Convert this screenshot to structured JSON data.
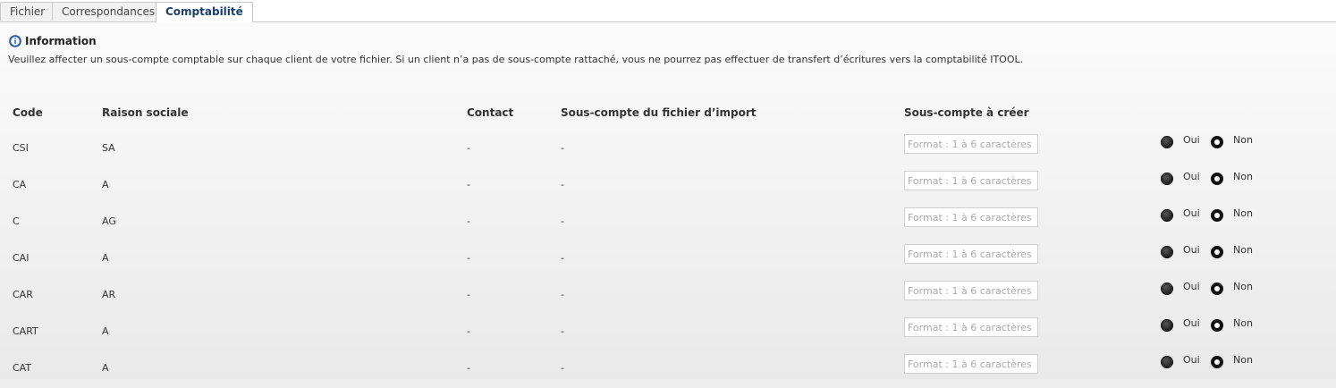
{
  "tabs": [
    {
      "label": "Fichier",
      "active": false
    },
    {
      "label": "Correspondances",
      "active": false
    },
    {
      "label": "Comptabilité",
      "active": true
    }
  ],
  "info": {
    "title": "Information",
    "text": "Veuillez affecter un sous-compte comptable sur chaque client de votre fichier. Si un client n’a pas de sous-compte rattaché, vous ne pourrez pas effectuer de transfert d’écritures vers la comptabilité ITOOL.",
    "icon": "info-icon",
    "icon_color": "#2e6cc0"
  },
  "table": {
    "headers": {
      "code": "Code",
      "raison": "Raison sociale",
      "contact": "Contact",
      "import": "Sous-compte du fichier d’import",
      "create": "Sous-compte à créer"
    },
    "input_placeholder": "Format : 1 à 6 caractères",
    "yes_label": "Oui",
    "no_label": "Non",
    "rows": [
      {
        "code": "CSI",
        "raison": "SA",
        "contact": "-",
        "import": "-",
        "selected": "Non"
      },
      {
        "code": "CA",
        "raison": "A",
        "contact": "-",
        "import": "-",
        "selected": "Non"
      },
      {
        "code": "C",
        "raison": "AG",
        "contact": "-",
        "import": "-",
        "selected": "Non"
      },
      {
        "code": "CAI",
        "raison": "A",
        "contact": "-",
        "import": "-",
        "selected": "Non"
      },
      {
        "code": "CAR",
        "raison": "AR",
        "contact": "-",
        "import": "-",
        "selected": "Non"
      },
      {
        "code": "CART",
        "raison": "A",
        "contact": "-",
        "import": "-",
        "selected": "Non"
      },
      {
        "code": "CAT",
        "raison": "A",
        "contact": "-",
        "import": "-",
        "selected": "Non"
      }
    ]
  }
}
